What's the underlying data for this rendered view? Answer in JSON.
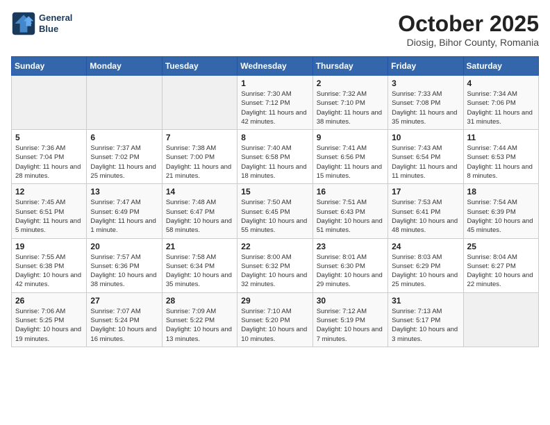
{
  "header": {
    "logo_line1": "General",
    "logo_line2": "Blue",
    "month": "October 2025",
    "location": "Diosig, Bihor County, Romania"
  },
  "weekdays": [
    "Sunday",
    "Monday",
    "Tuesday",
    "Wednesday",
    "Thursday",
    "Friday",
    "Saturday"
  ],
  "weeks": [
    [
      {
        "day": "",
        "info": ""
      },
      {
        "day": "",
        "info": ""
      },
      {
        "day": "",
        "info": ""
      },
      {
        "day": "1",
        "info": "Sunrise: 7:30 AM\nSunset: 7:12 PM\nDaylight: 11 hours\nand 42 minutes."
      },
      {
        "day": "2",
        "info": "Sunrise: 7:32 AM\nSunset: 7:10 PM\nDaylight: 11 hours\nand 38 minutes."
      },
      {
        "day": "3",
        "info": "Sunrise: 7:33 AM\nSunset: 7:08 PM\nDaylight: 11 hours\nand 35 minutes."
      },
      {
        "day": "4",
        "info": "Sunrise: 7:34 AM\nSunset: 7:06 PM\nDaylight: 11 hours\nand 31 minutes."
      }
    ],
    [
      {
        "day": "5",
        "info": "Sunrise: 7:36 AM\nSunset: 7:04 PM\nDaylight: 11 hours\nand 28 minutes."
      },
      {
        "day": "6",
        "info": "Sunrise: 7:37 AM\nSunset: 7:02 PM\nDaylight: 11 hours\nand 25 minutes."
      },
      {
        "day": "7",
        "info": "Sunrise: 7:38 AM\nSunset: 7:00 PM\nDaylight: 11 hours\nand 21 minutes."
      },
      {
        "day": "8",
        "info": "Sunrise: 7:40 AM\nSunset: 6:58 PM\nDaylight: 11 hours\nand 18 minutes."
      },
      {
        "day": "9",
        "info": "Sunrise: 7:41 AM\nSunset: 6:56 PM\nDaylight: 11 hours\nand 15 minutes."
      },
      {
        "day": "10",
        "info": "Sunrise: 7:43 AM\nSunset: 6:54 PM\nDaylight: 11 hours\nand 11 minutes."
      },
      {
        "day": "11",
        "info": "Sunrise: 7:44 AM\nSunset: 6:53 PM\nDaylight: 11 hours\nand 8 minutes."
      }
    ],
    [
      {
        "day": "12",
        "info": "Sunrise: 7:45 AM\nSunset: 6:51 PM\nDaylight: 11 hours\nand 5 minutes."
      },
      {
        "day": "13",
        "info": "Sunrise: 7:47 AM\nSunset: 6:49 PM\nDaylight: 11 hours\nand 1 minute."
      },
      {
        "day": "14",
        "info": "Sunrise: 7:48 AM\nSunset: 6:47 PM\nDaylight: 10 hours\nand 58 minutes."
      },
      {
        "day": "15",
        "info": "Sunrise: 7:50 AM\nSunset: 6:45 PM\nDaylight: 10 hours\nand 55 minutes."
      },
      {
        "day": "16",
        "info": "Sunrise: 7:51 AM\nSunset: 6:43 PM\nDaylight: 10 hours\nand 51 minutes."
      },
      {
        "day": "17",
        "info": "Sunrise: 7:53 AM\nSunset: 6:41 PM\nDaylight: 10 hours\nand 48 minutes."
      },
      {
        "day": "18",
        "info": "Sunrise: 7:54 AM\nSunset: 6:39 PM\nDaylight: 10 hours\nand 45 minutes."
      }
    ],
    [
      {
        "day": "19",
        "info": "Sunrise: 7:55 AM\nSunset: 6:38 PM\nDaylight: 10 hours\nand 42 minutes."
      },
      {
        "day": "20",
        "info": "Sunrise: 7:57 AM\nSunset: 6:36 PM\nDaylight: 10 hours\nand 38 minutes."
      },
      {
        "day": "21",
        "info": "Sunrise: 7:58 AM\nSunset: 6:34 PM\nDaylight: 10 hours\nand 35 minutes."
      },
      {
        "day": "22",
        "info": "Sunrise: 8:00 AM\nSunset: 6:32 PM\nDaylight: 10 hours\nand 32 minutes."
      },
      {
        "day": "23",
        "info": "Sunrise: 8:01 AM\nSunset: 6:30 PM\nDaylight: 10 hours\nand 29 minutes."
      },
      {
        "day": "24",
        "info": "Sunrise: 8:03 AM\nSunset: 6:29 PM\nDaylight: 10 hours\nand 25 minutes."
      },
      {
        "day": "25",
        "info": "Sunrise: 8:04 AM\nSunset: 6:27 PM\nDaylight: 10 hours\nand 22 minutes."
      }
    ],
    [
      {
        "day": "26",
        "info": "Sunrise: 7:06 AM\nSunset: 5:25 PM\nDaylight: 10 hours\nand 19 minutes."
      },
      {
        "day": "27",
        "info": "Sunrise: 7:07 AM\nSunset: 5:24 PM\nDaylight: 10 hours\nand 16 minutes."
      },
      {
        "day": "28",
        "info": "Sunrise: 7:09 AM\nSunset: 5:22 PM\nDaylight: 10 hours\nand 13 minutes."
      },
      {
        "day": "29",
        "info": "Sunrise: 7:10 AM\nSunset: 5:20 PM\nDaylight: 10 hours\nand 10 minutes."
      },
      {
        "day": "30",
        "info": "Sunrise: 7:12 AM\nSunset: 5:19 PM\nDaylight: 10 hours\nand 7 minutes."
      },
      {
        "day": "31",
        "info": "Sunrise: 7:13 AM\nSunset: 5:17 PM\nDaylight: 10 hours\nand 3 minutes."
      },
      {
        "day": "",
        "info": ""
      }
    ]
  ]
}
